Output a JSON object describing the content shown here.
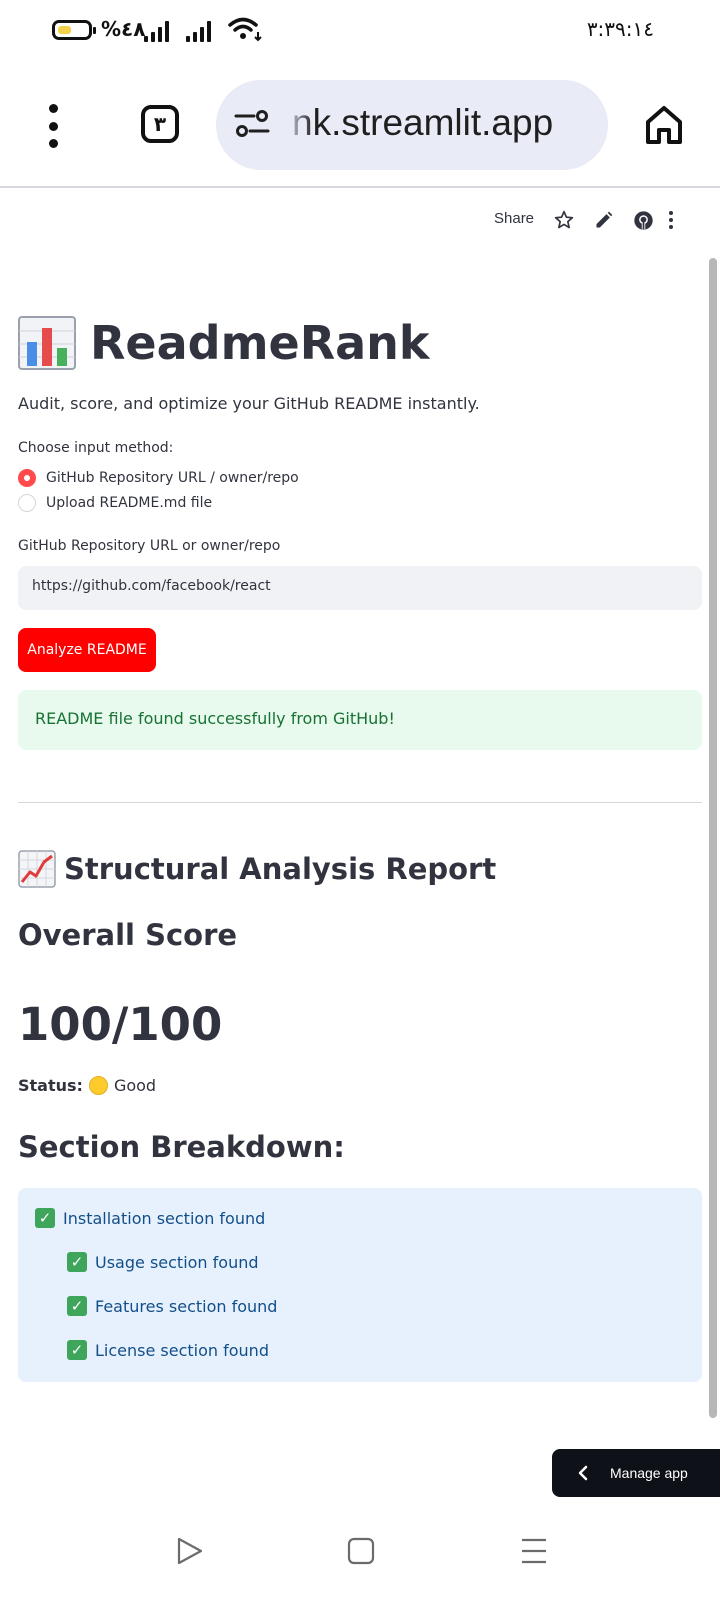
{
  "status_bar": {
    "battery_percent": "%٤٨",
    "battery_level": 0.45,
    "time": "٣:٣٩:١٤"
  },
  "browser": {
    "tab_count": "٣",
    "url_visible": "nk.streamlit.app",
    "icons": [
      "more-vert-icon",
      "tabs-icon",
      "site-settings-icon",
      "home-icon"
    ]
  },
  "app_toolbar": {
    "share_label": "Share",
    "icons": [
      "star-icon",
      "edit-icon",
      "github-icon",
      "more-vert-icon"
    ]
  },
  "app": {
    "title": "ReadmeRank",
    "title_icon": "bar-chart-icon",
    "subtitle": "Audit, score, and optimize your GitHub README instantly.",
    "input_method_label": "Choose input method:",
    "options": [
      {
        "label": "GitHub Repository URL / owner/repo",
        "selected": true
      },
      {
        "label": "Upload README.md file",
        "selected": false
      }
    ],
    "repo_field_label": "GitHub Repository URL or owner/repo",
    "repo_value": "https://github.com/facebook/react",
    "analyze_button": "Analyze README",
    "success_message": "README file found successfully from GitHub!",
    "report_title": "Structural Analysis Report",
    "report_icon": "line-chart-icon",
    "overall_score_label": "Overall Score",
    "score": "100/100",
    "status_label": "Status:",
    "status_value": "Good",
    "status_color": "#fdcb2e",
    "breakdown_title": "Section Breakdown:",
    "sections": [
      "Installation section found",
      "Usage section found",
      "Features section found",
      "License section found"
    ]
  },
  "manage_app": {
    "label": "Manage app"
  },
  "colors": {
    "primary_button": "#ff0000",
    "radio_selected": "#ff4b4b",
    "success_bg": "#e8f9ee",
    "success_text": "#177233",
    "info_bg": "#e7f1fd",
    "info_text": "#124f8a"
  },
  "nav_bar": {
    "icons": [
      "back-triangle-icon",
      "home-square-icon",
      "recents-menu-icon"
    ]
  }
}
